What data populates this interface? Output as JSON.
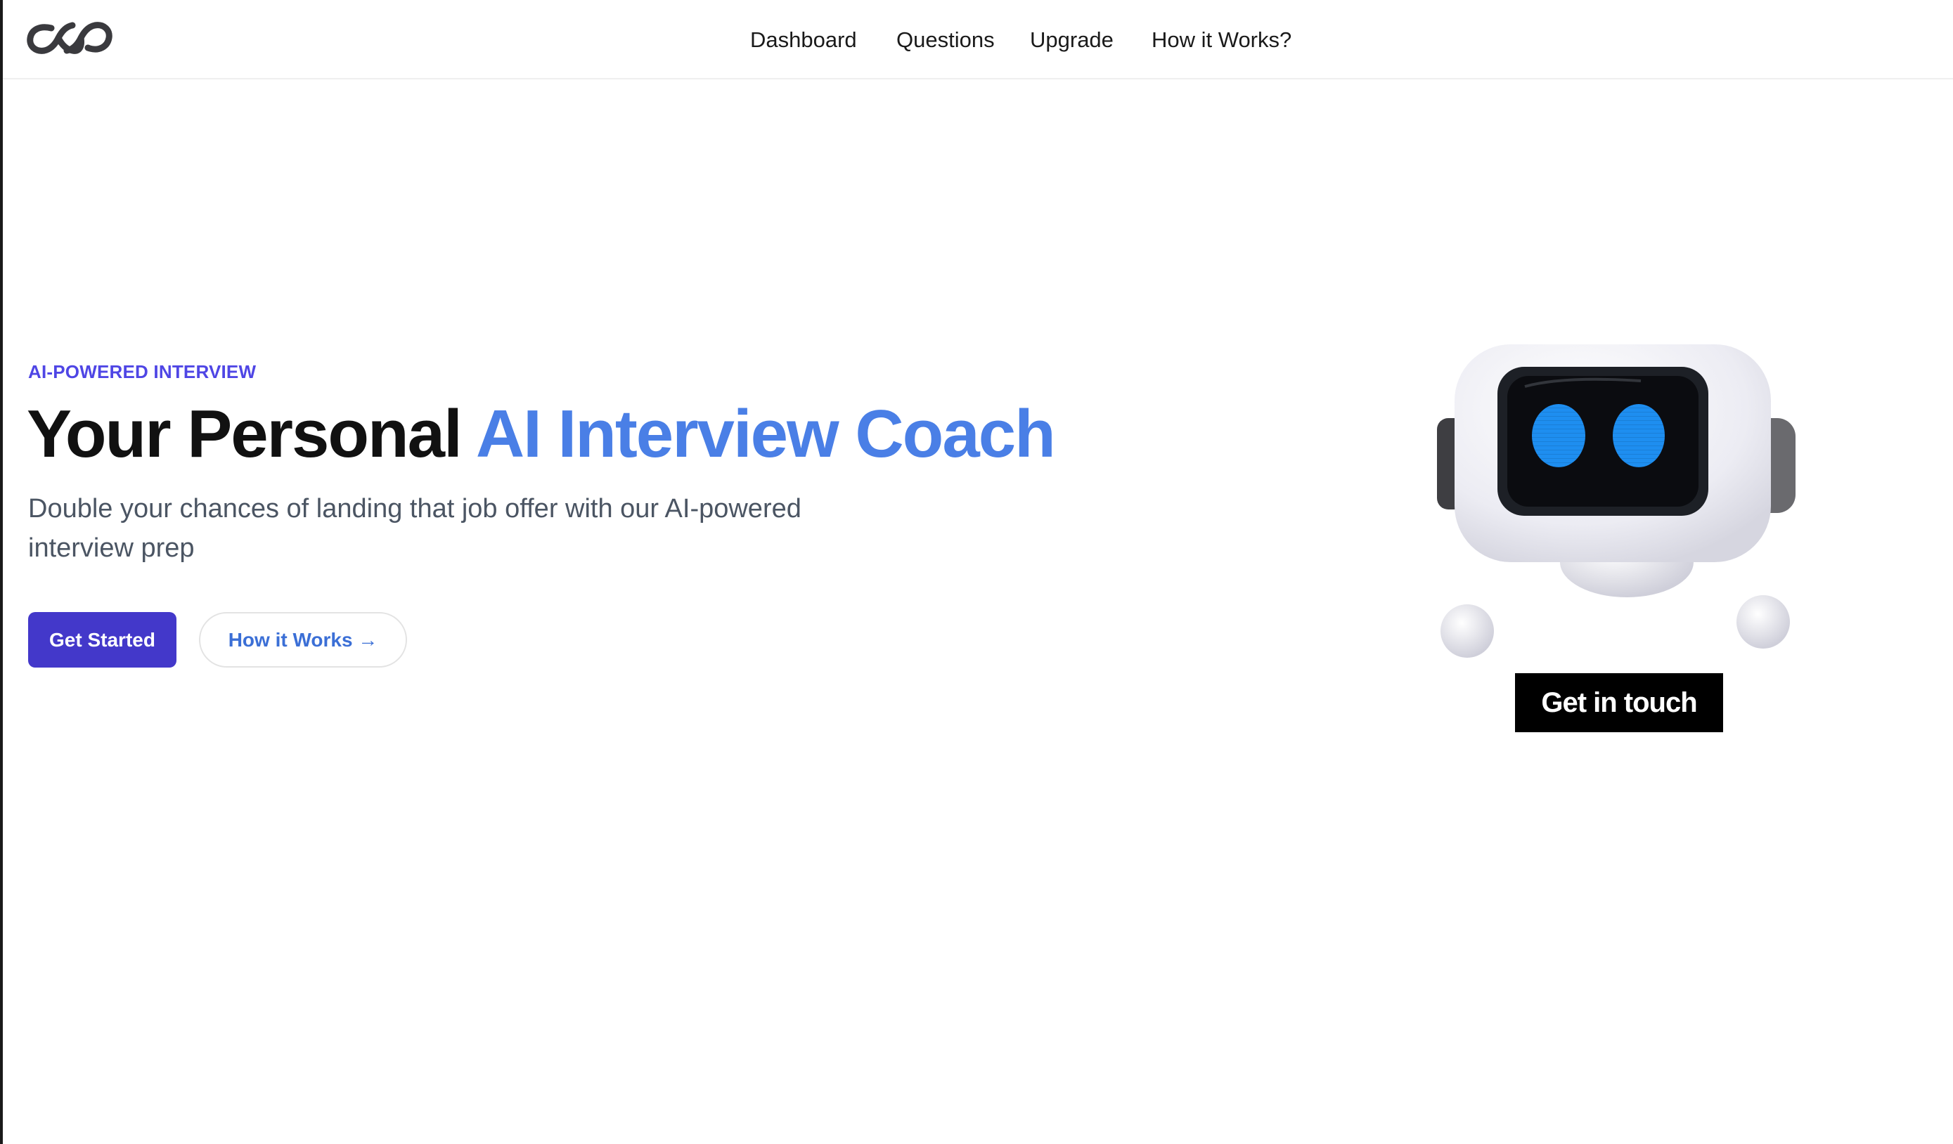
{
  "header": {
    "logo_icon": "infinity-chain-logo-icon",
    "nav": [
      {
        "label": "Dashboard"
      },
      {
        "label": "Questions"
      },
      {
        "label": "Upgrade"
      },
      {
        "label": "How it Works?"
      }
    ]
  },
  "hero": {
    "eyebrow": "AI-POWERED INTERVIEW",
    "headline_plain": "Your Personal",
    "headline_accent": "AI Interview Coach",
    "subtitle": "Double your chances of landing that job offer with our AI-powered interview prep",
    "primary_button": "Get Started",
    "secondary_button": "How it Works →",
    "contact_button": "Get in touch",
    "illustration": "robot-mascot-icon"
  },
  "colors": {
    "brand": "#4338ca",
    "accent_blue": "#4a7fe6",
    "eyebrow": "#4f46e5",
    "text_dark": "#111111",
    "text_muted": "#4b5563",
    "robot_eyes": "#1e8ef0"
  }
}
